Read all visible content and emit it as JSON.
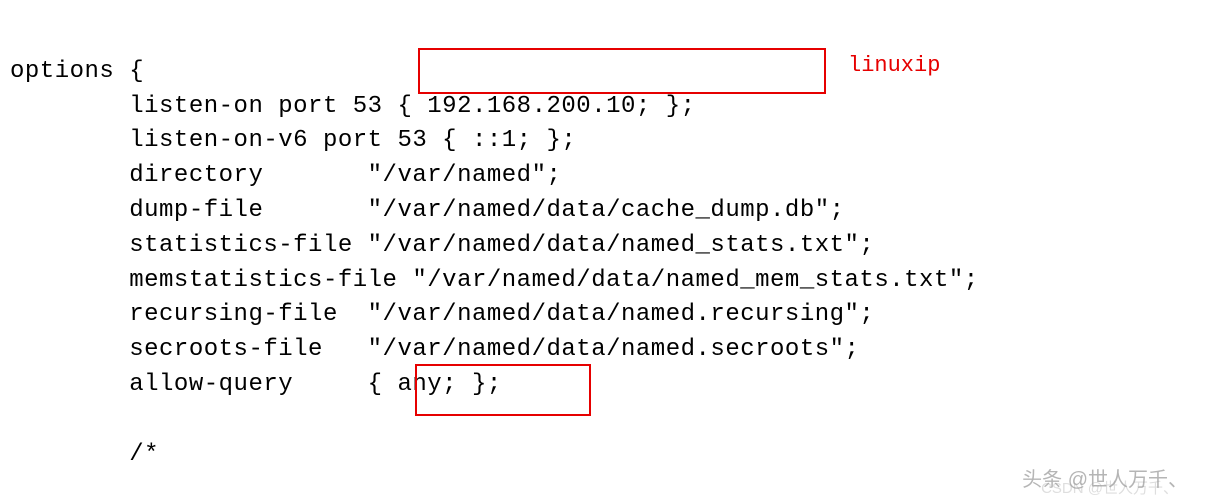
{
  "config": {
    "line1": "options {",
    "line2": "        listen-on port 53 { 192.168.200.10; };",
    "line3": "        listen-on-v6 port 53 { ::1; };",
    "line4": "        directory       \"/var/named\";",
    "line5": "        dump-file       \"/var/named/data/cache_dump.db\";",
    "line6": "        statistics-file \"/var/named/data/named_stats.txt\";",
    "line7": "        memstatistics-file \"/var/named/data/named_mem_stats.txt\";",
    "line8": "        recursing-file  \"/var/named/data/named.recursing\";",
    "line9": "        secroots-file   \"/var/named/data/named.secroots\";",
    "line10": "        allow-query     { any; };",
    "line11": "",
    "line12": "        /*"
  },
  "annotation": {
    "label": "linuxip"
  },
  "highlight_box_1": "{ 192.168.200.10; };",
  "highlight_box_2": "{ any; };",
  "watermarks": {
    "primary": "头条 @世人万千、",
    "secondary": "CSDN @世人万千、"
  }
}
